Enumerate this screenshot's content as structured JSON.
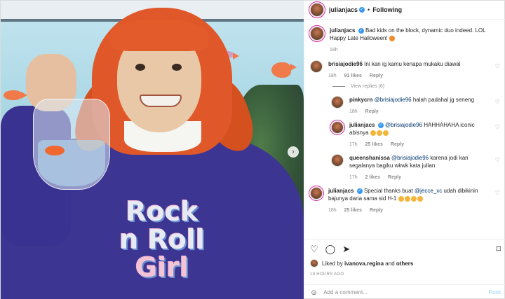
{
  "header": {
    "username": "julianjacs",
    "separator": "•",
    "follow_status": "Following"
  },
  "caption": {
    "username": "julianjacs",
    "text": "Bad kids on the block, dynamic duo indeed. LOL Happy Late Halloween!",
    "time": "18h"
  },
  "comments": [
    {
      "username": "brisiajodie96",
      "text": "Ini kan ig kamu kenapa mukaku diawal",
      "time": "18h",
      "likes": "91 likes",
      "reply": "Reply"
    },
    {
      "username": "julianjacs",
      "mention": "@jecce_xc",
      "text_before": "Special thanks buat",
      "text_after": "udah dibikinin bajunya daria sama sid H-1",
      "time": "18h",
      "likes": "25 likes",
      "reply": "Reply"
    }
  ],
  "view_replies": "View replies (6)",
  "replies": [
    {
      "username": "pinkycrn",
      "mention": "@brisiajodie96",
      "text": "halah padahal jg seneng",
      "time": "18h",
      "reply": "Reply"
    },
    {
      "username": "julianjacs",
      "mention": "@brisiajodie96",
      "text": "HAHHAHAHA iconic abisnya",
      "time": "17h",
      "likes": "25 likes",
      "reply": "Reply"
    },
    {
      "username": "queenshanissa",
      "mention": "@brisiajodie96",
      "text": "karena jodi kan segalanya bagiku wkwk kata julian",
      "time": "17h",
      "likes": "2 likes",
      "reply": "Reply"
    }
  ],
  "likes_line": {
    "prefix": "Liked by",
    "user": "ivanova.regina",
    "and": "and",
    "others": "others"
  },
  "timestamp": "18 HOURS AGO",
  "add_comment": {
    "placeholder": "Add a comment...",
    "post_label": "Post"
  },
  "photo": {
    "shirt_line1": "Rock",
    "shirt_line2": "n Roll",
    "shirt_line3": "Girl"
  },
  "icons": {
    "heart": "♡",
    "comment": "◯",
    "share": "➤",
    "save": "⌑",
    "smile": "☺",
    "next": "›"
  },
  "colors": {
    "verified": "#3897f0",
    "link": "#00376b",
    "muted": "#8e8e8e",
    "post_disabled": "#b2dffc"
  }
}
